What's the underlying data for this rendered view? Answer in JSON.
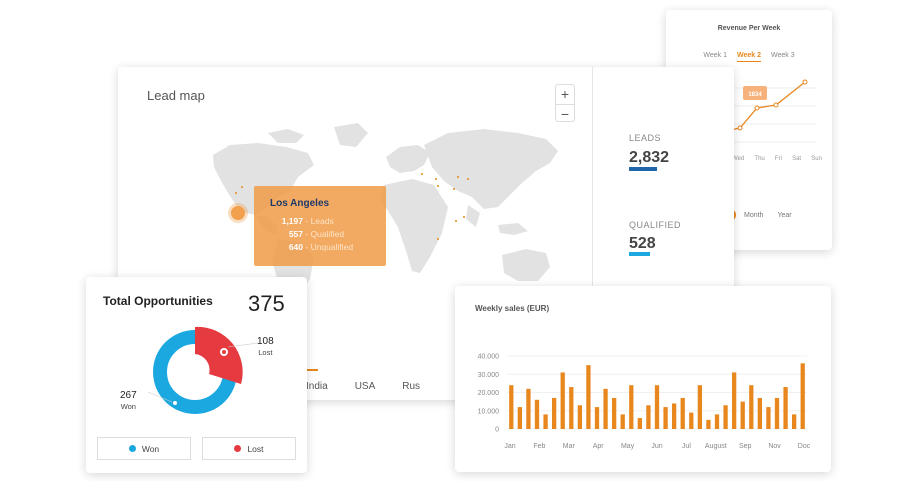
{
  "revenue": {
    "title": "Revenue Per Week",
    "weeks": [
      "Week 1",
      "Week 2",
      "Week 3"
    ],
    "active_week": "Week 2",
    "tooltip_value": "1834",
    "days": [
      "Wed",
      "Thu",
      "Fri",
      "Sat",
      "Sun"
    ],
    "ranges": [
      "Month",
      "Year"
    ]
  },
  "lead_map": {
    "title": "Lead map",
    "zoom_in": "+",
    "zoom_out": "−",
    "leads_label": "LEADS",
    "leads_value": "2,832",
    "qualified_label": "QUALIFIED",
    "qualified_value": "528",
    "tabs": [
      "India",
      "USA",
      "Rus"
    ],
    "popup": {
      "city": "Los Angeles",
      "leads_count": "1,197",
      "leads_label": "- Leads",
      "qualified_count": "557",
      "qualified_label": "- Qualified",
      "unqualified_count": "640",
      "unqualified_label": "- Unqualified"
    },
    "colors": {
      "leads_bar": "#1e66a8",
      "qualified_bar": "#1ba8e0",
      "accent": "#e8871e"
    }
  },
  "opportunities": {
    "title": "Total Opportunities",
    "total": "375",
    "lost_value": "108",
    "lost_label": "Lost",
    "won_value": "267",
    "won_label": "Won",
    "legend_won": "Won",
    "legend_lost": "Lost",
    "colors": {
      "won": "#1ba8e0",
      "lost": "#e53a40"
    }
  },
  "weekly_sales": {
    "title": "Weekly sales (EUR)",
    "chart_data": {
      "type": "bar",
      "title": "Weekly sales (EUR)",
      "ylim": [
        0,
        40000
      ],
      "yticks": [
        "40.000",
        "30.000",
        "20.000",
        "10.000",
        "0"
      ],
      "month_labels": [
        "Jan",
        "Feb",
        "Mar",
        "Apr",
        "May",
        "Jun",
        "Jul",
        "August",
        "Sep",
        "Nov",
        "Doc"
      ],
      "values": [
        24000,
        12000,
        22000,
        16000,
        8000,
        17000,
        31000,
        23000,
        13000,
        35000,
        12000,
        22000,
        17000,
        8000,
        24000,
        6000,
        13000,
        24000,
        12000,
        14000,
        17000,
        9000,
        24000,
        5000,
        8000,
        13000,
        31000,
        15000,
        24000,
        17000,
        12000,
        17000,
        23000,
        8000,
        36000
      ],
      "color": "#e8871e"
    }
  }
}
